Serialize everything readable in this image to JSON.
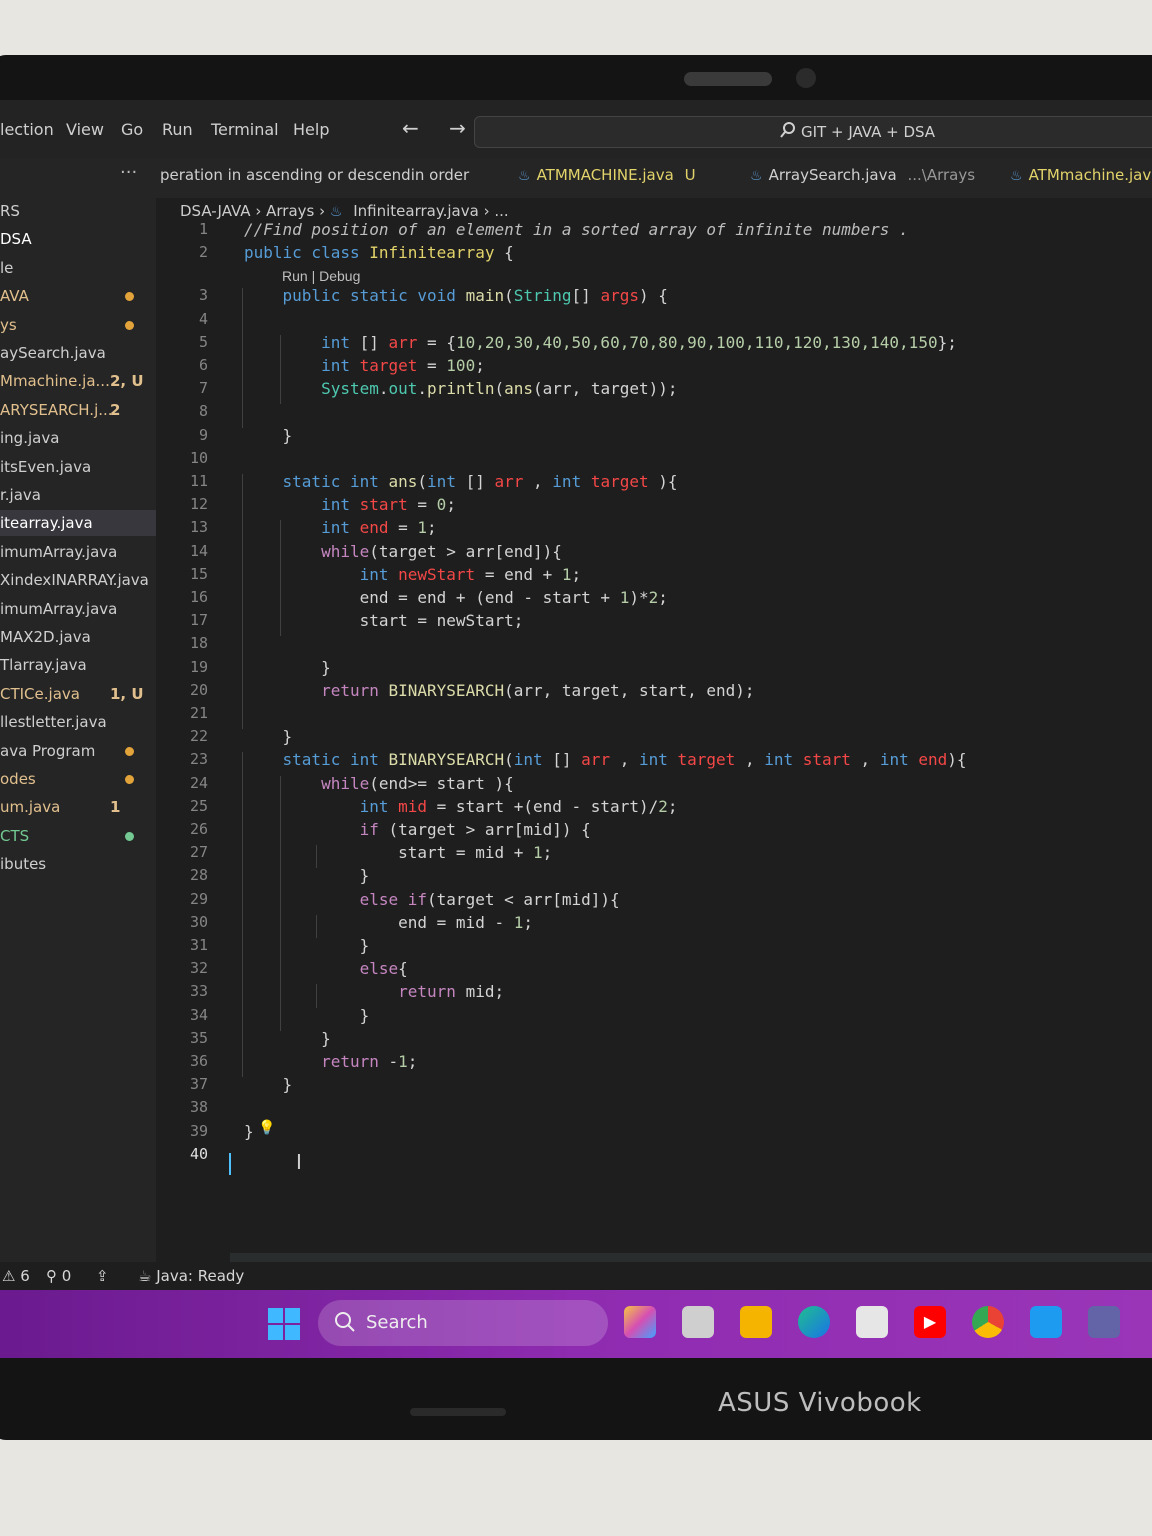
{
  "menu": {
    "items": [
      "lection",
      "View",
      "Go",
      "Run",
      "Terminal",
      "Help"
    ],
    "nav_arrows": "← →",
    "search_text": "GIT + JAVA + DSA"
  },
  "tabs": [
    {
      "label": "peration in ascending or descendin order",
      "suffix": "",
      "color": "#cfcfcf"
    },
    {
      "label": "ATMMACHINE.java",
      "suffix": "U",
      "color": "#e2d36a"
    },
    {
      "label": "ArraySearch.java",
      "suffix": "...\\Arrays",
      "color": "#cfcfcf"
    },
    {
      "label": "ATMmachine.java",
      "suffix": "",
      "color": "#e2d36a"
    }
  ],
  "tab_overflow": "···",
  "breadcrumb": [
    "DSA-JAVA",
    "Arrays",
    "Infinitearray.java",
    "..."
  ],
  "sidebar": [
    {
      "name": "RS",
      "badge": "",
      "color": "#cfcfcf",
      "dot": ""
    },
    {
      "name": " DSA",
      "badge": "",
      "color": "#ffffff",
      "dot": ""
    },
    {
      "name": "le",
      "badge": "",
      "color": "#cfcfcf",
      "dot": ""
    },
    {
      "name": "AVA",
      "badge": "",
      "color": "#e2c08d",
      "dot": "#e2a33a"
    },
    {
      "name": "ys",
      "badge": "",
      "color": "#e2c08d",
      "dot": "#e2a33a"
    },
    {
      "name": "aySearch.java",
      "badge": "",
      "color": "#cfcfcf",
      "dot": ""
    },
    {
      "name": "Mmachine.ja...",
      "badge": "2, U",
      "color": "#e2c08d",
      "dot": ""
    },
    {
      "name": "ARYSEARCH.j...",
      "badge": "2",
      "color": "#e2c08d",
      "dot": ""
    },
    {
      "name": "ing.java",
      "badge": "",
      "color": "#cfcfcf",
      "dot": ""
    },
    {
      "name": "itsEven.java",
      "badge": "",
      "color": "#cfcfcf",
      "dot": ""
    },
    {
      "name": "r.java",
      "badge": "",
      "color": "#cfcfcf",
      "dot": ""
    },
    {
      "name": "itearray.java",
      "badge": "",
      "color": "#ffffff",
      "dot": ""
    },
    {
      "name": "imumArray.java",
      "badge": "",
      "color": "#cfcfcf",
      "dot": ""
    },
    {
      "name": "XindexINARRAY.java",
      "badge": "",
      "color": "#cfcfcf",
      "dot": ""
    },
    {
      "name": "imumArray.java",
      "badge": "",
      "color": "#cfcfcf",
      "dot": ""
    },
    {
      "name": "MAX2D.java",
      "badge": "",
      "color": "#cfcfcf",
      "dot": ""
    },
    {
      "name": "Tlarray.java",
      "badge": "",
      "color": "#cfcfcf",
      "dot": ""
    },
    {
      "name": "CTICe.java",
      "badge": "1, U",
      "color": "#e2c08d",
      "dot": ""
    },
    {
      "name": "llestletter.java",
      "badge": "",
      "color": "#cfcfcf",
      "dot": ""
    },
    {
      "name": "ava Program",
      "badge": "",
      "color": "#cfcfcf",
      "dot": "#e2a33a"
    },
    {
      "name": "odes",
      "badge": "",
      "color": "#e2c08d",
      "dot": "#e2a33a"
    },
    {
      "name": "um.java",
      "badge": "1",
      "color": "#e2c08d",
      "dot": ""
    },
    {
      "name": "CTS",
      "badge": "",
      "color": "#73c991",
      "dot": "#73c991"
    },
    {
      "name": "ibutes",
      "badge": "",
      "color": "#cfcfcf",
      "dot": ""
    }
  ],
  "codelens": "Run | Debug",
  "line_numbers": [
    "1",
    "2",
    "3",
    "4",
    "5",
    "6",
    "7",
    "8",
    "9",
    "10",
    "11",
    "12",
    "13",
    "14",
    "15",
    "16",
    "17",
    "18",
    "19",
    "20",
    "21",
    "22",
    "23",
    "24",
    "25",
    "26",
    "27",
    "28",
    "29",
    "30",
    "31",
    "32",
    "33",
    "34",
    "35",
    "36",
    "37",
    "38",
    "39",
    "40"
  ],
  "code": [
    [
      [
        "com",
        "//Find position of an element in a sorted array of infinite numbers ."
      ]
    ],
    [
      [
        "kw",
        "public class "
      ],
      [
        "cls",
        "Infinitearray"
      ],
      [
        "op",
        " {"
      ]
    ],
    [
      [
        "op",
        "    "
      ],
      [
        "kw",
        "public static void "
      ],
      [
        "fn",
        "main"
      ],
      [
        "op",
        "("
      ],
      [
        "ty",
        "String"
      ],
      [
        "op",
        "[] "
      ],
      [
        "var",
        "args"
      ],
      [
        "op",
        ") {"
      ]
    ],
    [
      [
        "op",
        ""
      ]
    ],
    [
      [
        "op",
        "        "
      ],
      [
        "kw",
        "int "
      ],
      [
        "op",
        "[] "
      ],
      [
        "var",
        "arr"
      ],
      [
        "op",
        " = {"
      ],
      [
        "num",
        "10,20,30,40,50,60,70,80,90,100,110,120,130,140,150"
      ],
      [
        "op",
        "};"
      ]
    ],
    [
      [
        "op",
        "        "
      ],
      [
        "kw",
        "int "
      ],
      [
        "var",
        "target"
      ],
      [
        "op",
        " = "
      ],
      [
        "num",
        "100"
      ],
      [
        "op",
        ";"
      ]
    ],
    [
      [
        "op",
        "        "
      ],
      [
        "ty",
        "System"
      ],
      [
        "op",
        "."
      ],
      [
        "ty",
        "out"
      ],
      [
        "op",
        "."
      ],
      [
        "fn",
        "println"
      ],
      [
        "op",
        "("
      ],
      [
        "fn",
        "ans"
      ],
      [
        "op",
        "(arr, target));"
      ]
    ],
    [
      [
        "op",
        ""
      ]
    ],
    [
      [
        "op",
        "    }"
      ]
    ],
    [
      [
        "op",
        ""
      ]
    ],
    [
      [
        "op",
        "    "
      ],
      [
        "kw",
        "static int "
      ],
      [
        "fn",
        "ans"
      ],
      [
        "op",
        "("
      ],
      [
        "kw",
        "int "
      ],
      [
        "op",
        "[] "
      ],
      [
        "var",
        "arr"
      ],
      [
        "op",
        " , "
      ],
      [
        "kw",
        "int "
      ],
      [
        "var",
        "target"
      ],
      [
        "op",
        " ){"
      ]
    ],
    [
      [
        "op",
        "        "
      ],
      [
        "kw",
        "int "
      ],
      [
        "var",
        "start"
      ],
      [
        "op",
        " = "
      ],
      [
        "num",
        "0"
      ],
      [
        "op",
        ";"
      ]
    ],
    [
      [
        "op",
        "        "
      ],
      [
        "kw",
        "int "
      ],
      [
        "var",
        "end"
      ],
      [
        "op",
        " = "
      ],
      [
        "num",
        "1"
      ],
      [
        "op",
        ";"
      ]
    ],
    [
      [
        "op",
        "        "
      ],
      [
        "ctl",
        "while"
      ],
      [
        "op",
        "(target > arr[end]){"
      ]
    ],
    [
      [
        "op",
        "            "
      ],
      [
        "kw",
        "int "
      ],
      [
        "var",
        "newStart"
      ],
      [
        "op",
        " = end + "
      ],
      [
        "num",
        "1"
      ],
      [
        "op",
        ";"
      ]
    ],
    [
      [
        "op",
        "            end = end + (end - start + "
      ],
      [
        "num",
        "1"
      ],
      [
        "op",
        ")*"
      ],
      [
        "num",
        "2"
      ],
      [
        "op",
        ";"
      ]
    ],
    [
      [
        "op",
        "            start = newStart;"
      ]
    ],
    [
      [
        "op",
        ""
      ]
    ],
    [
      [
        "op",
        "        }"
      ]
    ],
    [
      [
        "op",
        "        "
      ],
      [
        "ctl",
        "return "
      ],
      [
        "fn",
        "BINARYSEARCH"
      ],
      [
        "op",
        "(arr, target, start, end);"
      ]
    ],
    [
      [
        "op",
        ""
      ]
    ],
    [
      [
        "op",
        "    }"
      ]
    ],
    [
      [
        "op",
        "    "
      ],
      [
        "kw",
        "static int "
      ],
      [
        "fn",
        "BINARYSEARCH"
      ],
      [
        "op",
        "("
      ],
      [
        "kw",
        "int "
      ],
      [
        "op",
        "[] "
      ],
      [
        "var",
        "arr"
      ],
      [
        "op",
        " , "
      ],
      [
        "kw",
        "int "
      ],
      [
        "var",
        "target"
      ],
      [
        "op",
        " , "
      ],
      [
        "kw",
        "int "
      ],
      [
        "var",
        "start"
      ],
      [
        "op",
        " , "
      ],
      [
        "kw",
        "int "
      ],
      [
        "var",
        "end"
      ],
      [
        "op",
        "){"
      ]
    ],
    [
      [
        "op",
        "        "
      ],
      [
        "ctl",
        "while"
      ],
      [
        "op",
        "(end>= start ){"
      ]
    ],
    [
      [
        "op",
        "            "
      ],
      [
        "kw",
        "int "
      ],
      [
        "var",
        "mid"
      ],
      [
        "op",
        " = start +(end - start)/"
      ],
      [
        "num",
        "2"
      ],
      [
        "op",
        ";"
      ]
    ],
    [
      [
        "op",
        "            "
      ],
      [
        "ctl",
        "if "
      ],
      [
        "op",
        "(target > arr[mid]) {"
      ]
    ],
    [
      [
        "op",
        "                start = mid + "
      ],
      [
        "num",
        "1"
      ],
      [
        "op",
        ";"
      ]
    ],
    [
      [
        "op",
        "            }"
      ]
    ],
    [
      [
        "op",
        "            "
      ],
      [
        "ctl",
        "else if"
      ],
      [
        "op",
        "(target < arr[mid]){"
      ]
    ],
    [
      [
        "op",
        "                end = mid - "
      ],
      [
        "num",
        "1"
      ],
      [
        "op",
        ";"
      ]
    ],
    [
      [
        "op",
        "            }"
      ]
    ],
    [
      [
        "op",
        "            "
      ],
      [
        "ctl",
        "else"
      ],
      [
        "op",
        "{"
      ]
    ],
    [
      [
        "op",
        "                "
      ],
      [
        "ctl",
        "return "
      ],
      [
        "op",
        "mid;"
      ]
    ],
    [
      [
        "op",
        "            }"
      ]
    ],
    [
      [
        "op",
        "        }"
      ]
    ],
    [
      [
        "op",
        "        "
      ],
      [
        "ctl",
        "return "
      ],
      [
        "op",
        "-"
      ],
      [
        "num",
        "1"
      ],
      [
        "op",
        ";"
      ]
    ],
    [
      [
        "op",
        "    }"
      ]
    ],
    [
      [
        "op",
        ""
      ]
    ],
    [
      [
        "op",
        "}"
      ]
    ],
    [
      [
        "op",
        ""
      ]
    ]
  ],
  "status": {
    "warnings": "6",
    "ports": "0",
    "java": "Java: Ready"
  },
  "taskbar": {
    "search_label": "Search"
  },
  "brand": "ASUS Vivobook"
}
